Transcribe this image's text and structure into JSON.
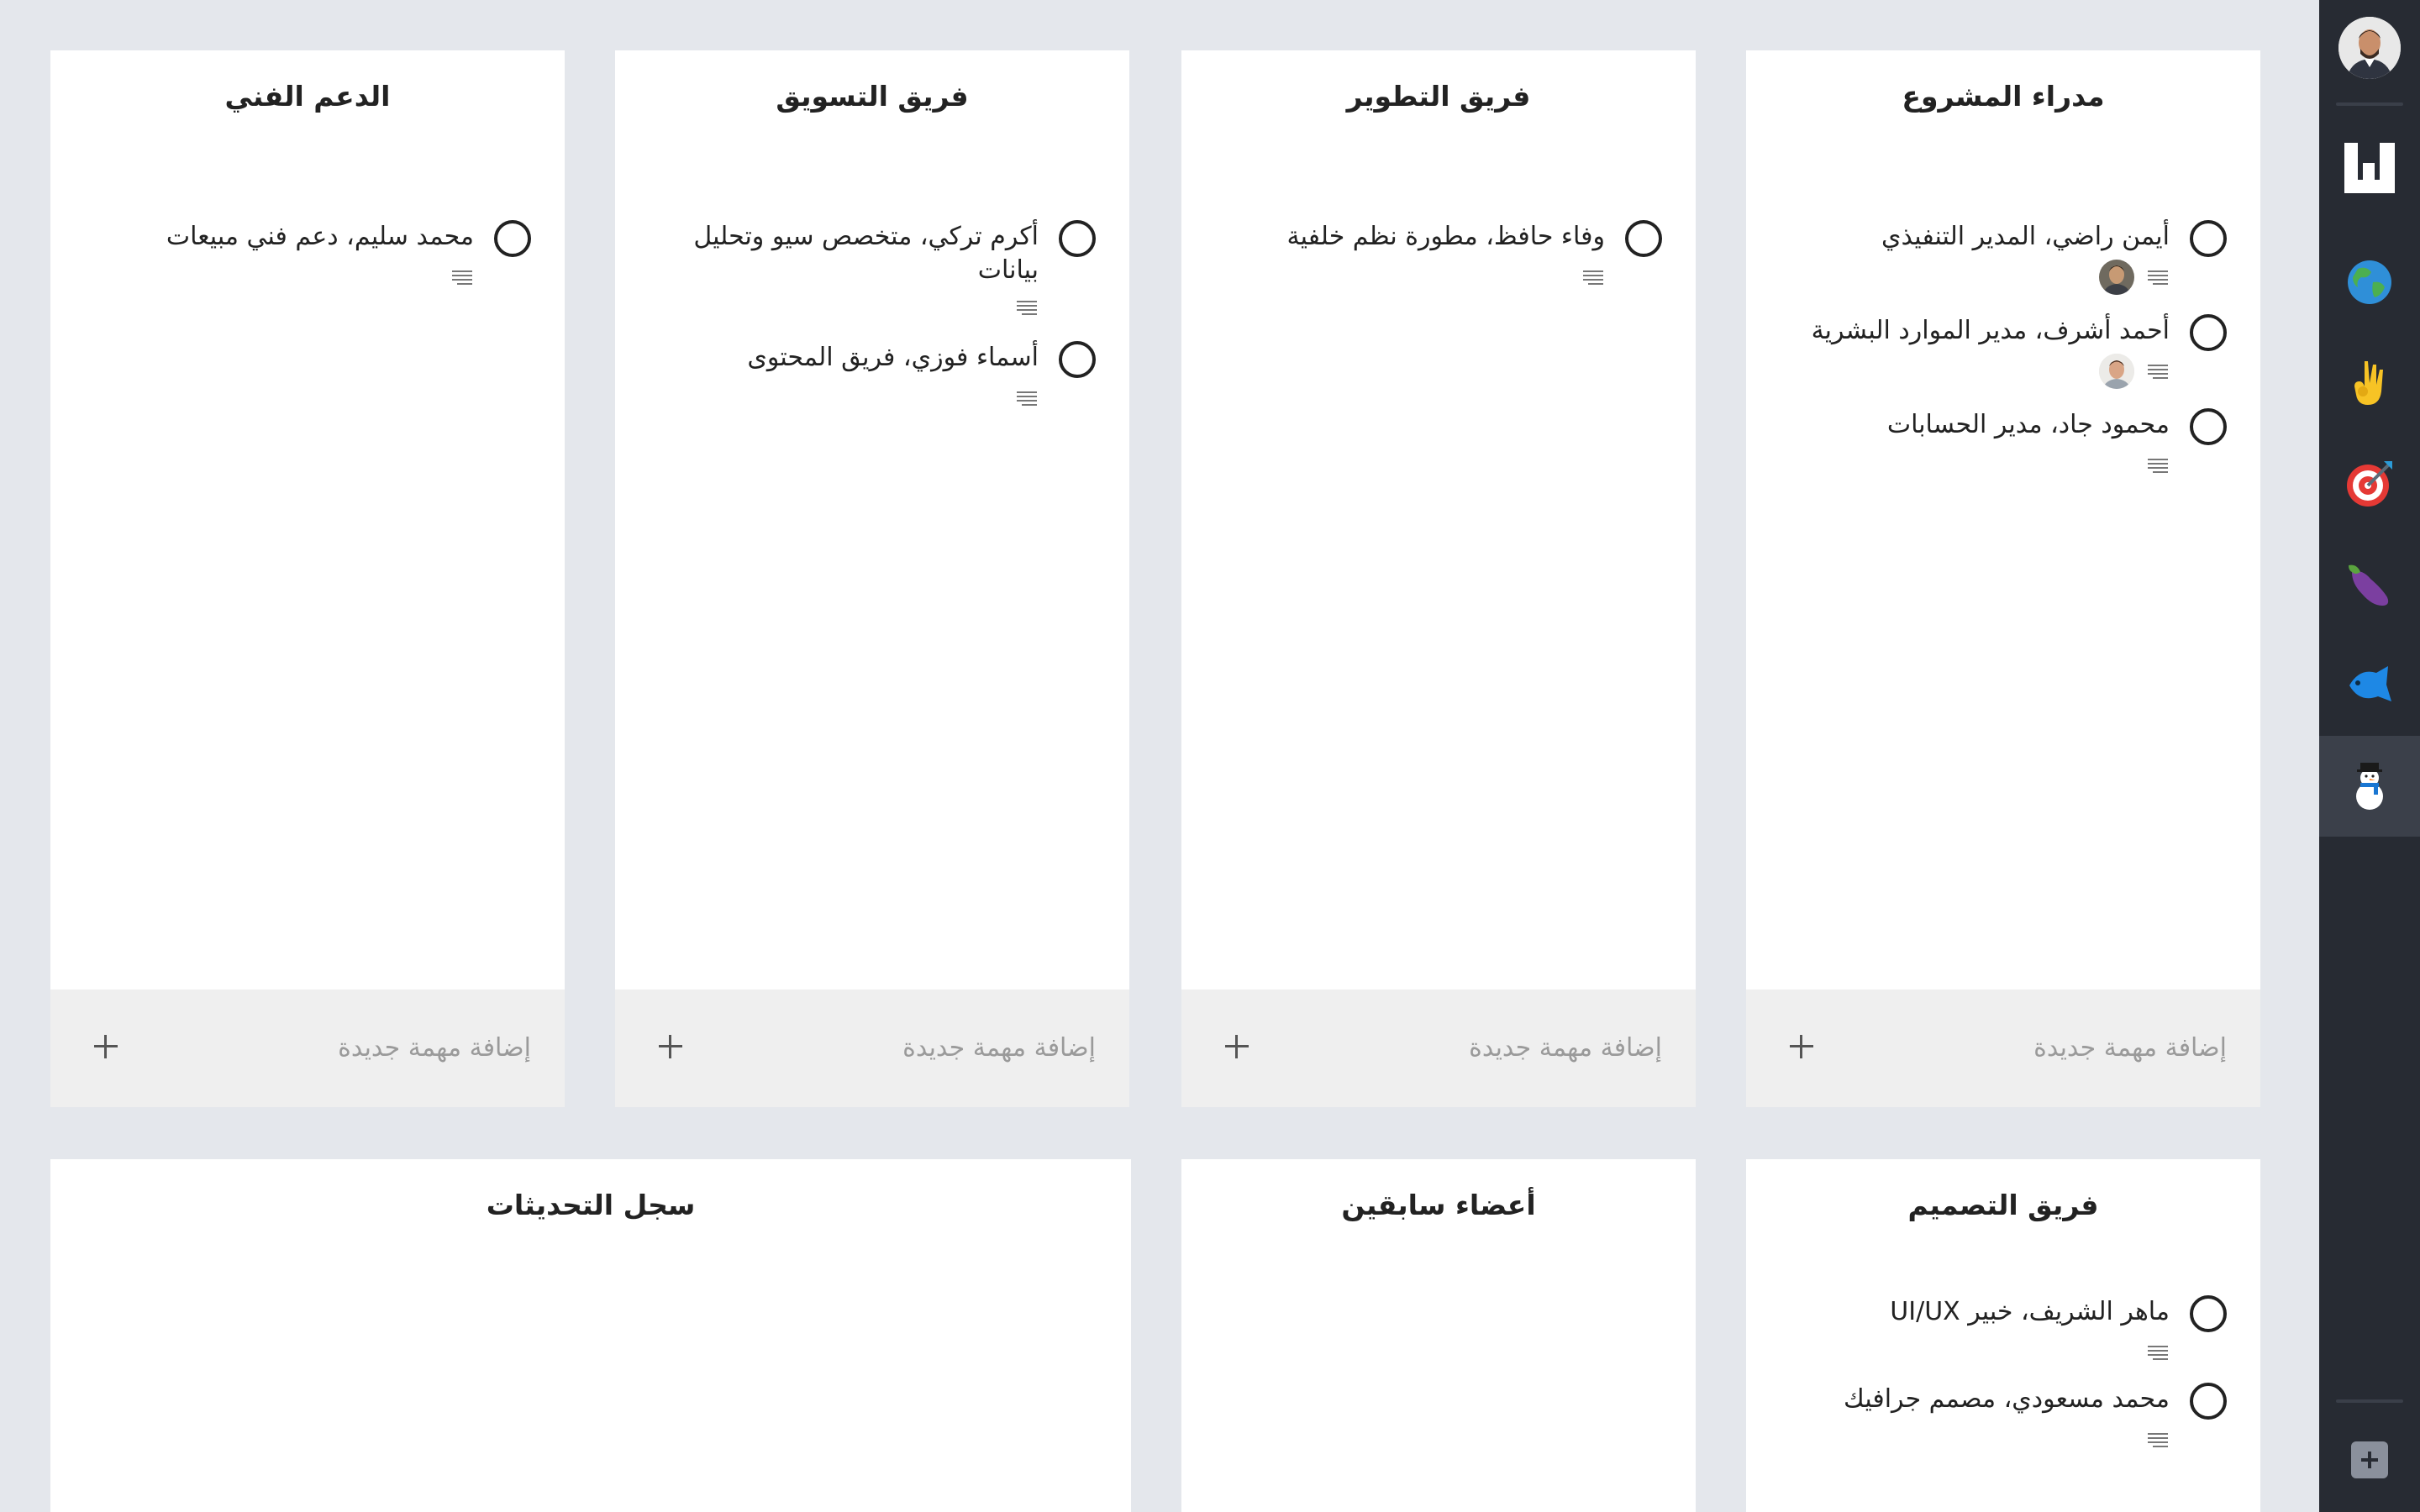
{
  "columns": [
    {
      "title": "مدراء المشروع",
      "tasks": [
        {
          "text": "أيمن راضي، المدير التنفيذي"
        },
        {
          "text": "أحمد أشرف، مدير الموارد البشرية"
        },
        {
          "text": "محمود جاد، مدير الحسابات"
        }
      ],
      "add_placeholder": "إضافة مهمة جديدة"
    },
    {
      "title": "فريق التطوير",
      "tasks": [
        {
          "text": "وفاء حافظ، مطورة نظم خلفية"
        }
      ],
      "add_placeholder": "إضافة مهمة جديدة"
    },
    {
      "title": "فريق التسويق",
      "tasks": [
        {
          "text": "أكرم تركي، متخصص سيو وتحليل بيانات"
        },
        {
          "text": "أسماء فوزي، فريق المحتوى"
        }
      ],
      "add_placeholder": "إضافة مهمة جديدة"
    },
    {
      "title": "الدعم الفني",
      "tasks": [
        {
          "text": "محمد سليم، دعم فني مبيعات"
        }
      ],
      "add_placeholder": "إضافة مهمة جديدة"
    },
    {
      "title": "فريق التصميم",
      "tasks": [
        {
          "text": "ماهر الشريف، خبير UI/UX"
        },
        {
          "text": "محمد مسعودي، مصمم جرافيك"
        }
      ]
    },
    {
      "title": "أعضاء سابقين",
      "tasks": []
    },
    {
      "title": "سجل التحديثات",
      "tasks": []
    }
  ],
  "sidebar": {
    "items": [
      {
        "icon": "board-logo-icon"
      },
      {
        "icon": "globe-emoji-icon"
      },
      {
        "icon": "ok-hand-emoji-icon"
      },
      {
        "icon": "target-emoji-icon"
      },
      {
        "icon": "eggplant-emoji-icon"
      },
      {
        "icon": "fish-emoji-icon"
      },
      {
        "icon": "snowman-emoji-icon",
        "active": true
      }
    ],
    "add_icon": "add-board-icon"
  },
  "colors": {
    "background": "#e4e7ec",
    "sidebar": "#272b33",
    "card": "#ffffff",
    "add_bar": "#efefef"
  }
}
